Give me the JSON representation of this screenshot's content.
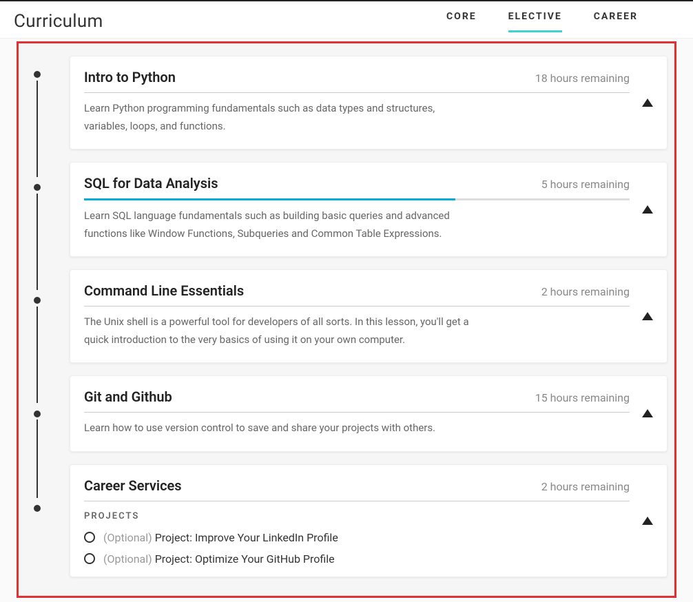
{
  "header": {
    "title": "Curriculum",
    "tabs": {
      "core": "CORE",
      "elective": "ELECTIVE",
      "career": "CAREER"
    },
    "active_tab": "elective"
  },
  "courses": [
    {
      "title": "Intro to Python",
      "remaining": "18 hours remaining",
      "description": "Learn Python programming fundamentals such as data types and structures, variables, loops, and functions.",
      "progress_percent": null
    },
    {
      "title": "SQL for Data Analysis",
      "remaining": "5 hours remaining",
      "description": "Learn SQL language fundamentals such as building basic queries and advanced functions like Window Functions, Subqueries and Common Table Expressions.",
      "progress_percent": 68
    },
    {
      "title": "Command Line Essentials",
      "remaining": "2 hours remaining",
      "description": "The Unix shell is a powerful tool for developers of all sorts. In this lesson, you'll get a quick introduction to the very basics of using it on your own computer.",
      "progress_percent": null
    },
    {
      "title": "Git and Github",
      "remaining": "15 hours remaining",
      "description": "Learn how to use version control to save and share your projects with others.",
      "progress_percent": null
    },
    {
      "title": "Career Services",
      "remaining": "2 hours remaining",
      "description": null,
      "progress_percent": null,
      "projects_label": "PROJECTS",
      "projects": [
        {
          "optional_prefix": "(Optional)",
          "name": "Project: Improve Your LinkedIn Profile"
        },
        {
          "optional_prefix": "(Optional)",
          "name": "Project: Optimize Your GitHub Profile"
        }
      ]
    }
  ]
}
